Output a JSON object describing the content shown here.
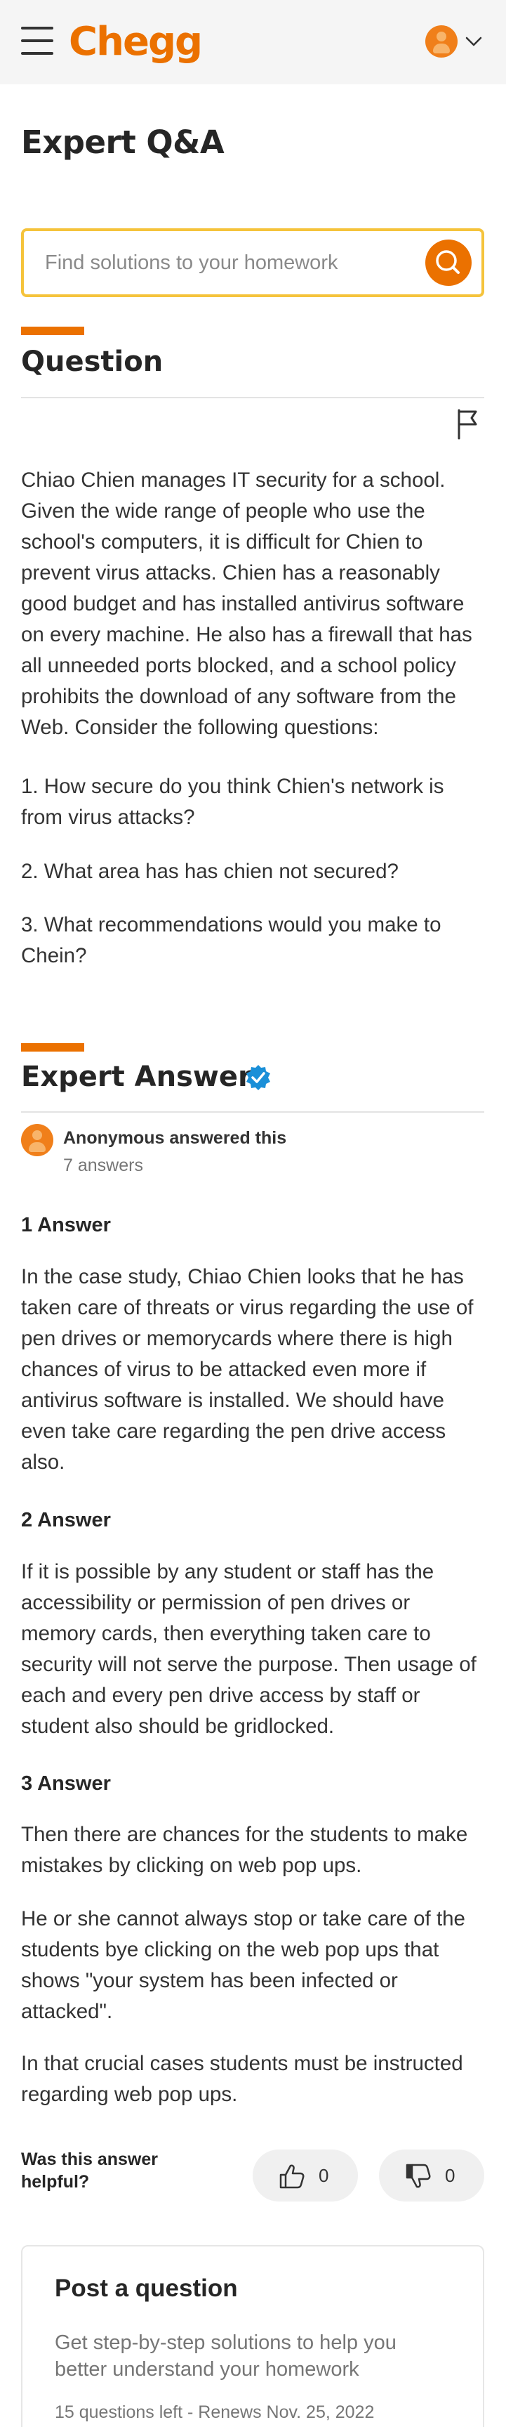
{
  "header": {
    "logo": "Chegg",
    "menu_icon": "hamburger-menu-icon",
    "account_icon": "user-avatar-icon",
    "dropdown_icon": "chevron-down-icon",
    "brand_color": "#eb7100"
  },
  "page": {
    "title": "Expert Q&A"
  },
  "search": {
    "placeholder": "Find solutions to your homework",
    "button_icon": "search-icon",
    "border_color": "#f5c33b"
  },
  "question": {
    "heading": "Question",
    "flag_icon": "flag-icon",
    "body": "Chiao Chien manages IT security for a school. Given the wide range of people who use the school's computers, it is difficult for Chien to prevent virus attacks. Chien has a reasonably good budget and has installed antivirus software on every machine. He also has a firewall that has all unneeded ports blocked, and a school policy prohibits the download of any software from the Web. Consider the following questions:",
    "items": [
      "1. How secure do you think Chien's network is from virus attacks?",
      "2. What area has has chien not secured?",
      "3. What recommendations would you make to Chein?"
    ]
  },
  "answer": {
    "heading": "Expert Answer",
    "verified_icon": "verified-badge-icon",
    "author": "Anonymous answered this",
    "author_count": "7 answers",
    "sections": [
      {
        "heading": "1 Answer",
        "paragraphs": [
          "In the case study, Chiao Chien looks that he has taken care of threats or virus regarding the use of pen drives or memorycards where there is high chances of virus to be attacked even more if antivirus software is installed. We should have even take care regarding the pen drive access also."
        ]
      },
      {
        "heading": "2 Answer",
        "paragraphs": [
          "If it is possible by any student or staff has the accessibility or permission of pen drives or memory cards, then everything taken care to security will not serve the purpose. Then usage of each and every pen drive access by staff or student also should be gridlocked."
        ]
      },
      {
        "heading": "3 Answer",
        "paragraphs": [
          "Then there are chances for the students to make mistakes by clicking on web pop ups.",
          "He or she cannot always stop or take care of the students bye clicking on the web pop ups that shows \"your system has been infected or attacked\".",
          "In that crucial cases students must be instructed regarding web pop ups."
        ]
      }
    ]
  },
  "feedback": {
    "label": "Was this answer helpful?",
    "upvote_count": "0",
    "downvote_count": "0",
    "upvote_icon": "thumbs-up-icon",
    "downvote_icon": "thumbs-down-icon"
  },
  "post_card": {
    "title": "Post a question",
    "description": "Get step-by-step solutions to help you better understand your homework",
    "quota": "15 questions left - Renews Nov. 25, 2022"
  }
}
